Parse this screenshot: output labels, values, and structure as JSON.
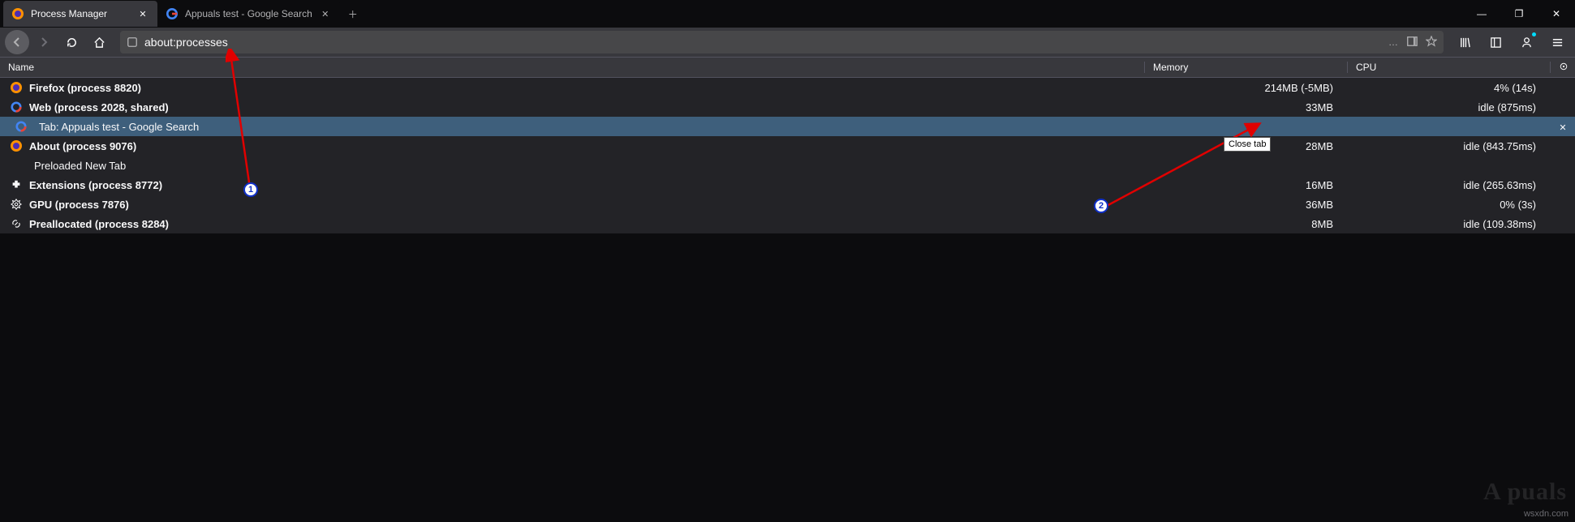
{
  "window": {
    "minimize": "—",
    "maximize": "❐",
    "close": "✕"
  },
  "tabs": [
    {
      "title": "Process Manager",
      "active": true,
      "icon": "firefox"
    },
    {
      "title": "Appuals test - Google Search",
      "active": false,
      "icon": "google"
    }
  ],
  "nav": {
    "url": "about:processes",
    "page_actions_more": "…"
  },
  "columns": {
    "name": "Name",
    "memory": "Memory",
    "cpu": "CPU"
  },
  "rows": [
    {
      "icon": "firefox",
      "name": "Firefox (process 8820)",
      "bold": true,
      "mem": "214MB (-5MB)",
      "cpu": "4% (14s)",
      "child": false
    },
    {
      "icon": "google",
      "name": "Web (process 2028, shared)",
      "bold": true,
      "mem": "33MB",
      "cpu": "idle (875ms)",
      "child": false
    },
    {
      "icon": "google",
      "name": "Tab: Appuals test - Google Search",
      "bold": false,
      "mem": "",
      "cpu": "",
      "child": true,
      "selected": true,
      "closable": true
    },
    {
      "icon": "firefox",
      "name": "About (process 9076)",
      "bold": true,
      "mem": "28MB",
      "cpu": "idle (843.75ms)",
      "child": false
    },
    {
      "icon": "none",
      "name": "Preloaded New Tab",
      "bold": false,
      "mem": "",
      "cpu": "",
      "child": true
    },
    {
      "icon": "extension",
      "name": "Extensions (process 8772)",
      "bold": true,
      "mem": "16MB",
      "cpu": "idle (265.63ms)",
      "child": false
    },
    {
      "icon": "gpu",
      "name": "GPU (process 7876)",
      "bold": true,
      "mem": "36MB",
      "cpu": "0% (3s)",
      "child": false
    },
    {
      "icon": "link",
      "name": "Preallocated (process 8284)",
      "bold": true,
      "mem": "8MB",
      "cpu": "idle (109.38ms)",
      "child": false
    }
  ],
  "tooltip": "Close tab",
  "annotations": {
    "label1": "1",
    "label2": "2"
  },
  "watermark": "wsxdn.com",
  "brand": "A  puals"
}
